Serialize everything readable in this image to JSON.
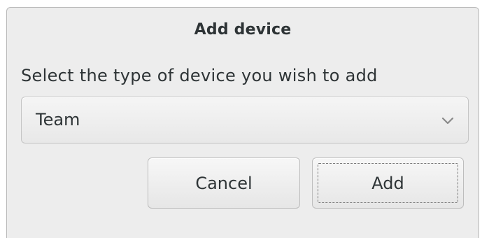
{
  "dialog": {
    "title": "Add device",
    "prompt": "Select the type of device you wish to add",
    "device_type": {
      "selected": "Team",
      "icon": "chevron-down-icon"
    },
    "buttons": {
      "cancel_label": "Cancel",
      "add_label": "Add"
    }
  }
}
